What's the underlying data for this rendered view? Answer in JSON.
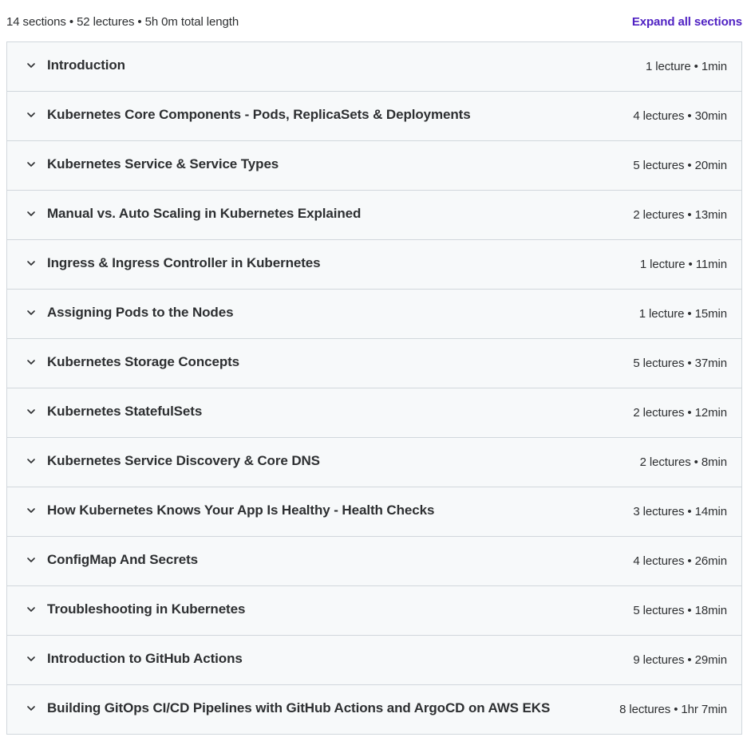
{
  "summary": {
    "text": "14 sections • 52 lectures • 5h 0m total length",
    "expand_label": "Expand all sections"
  },
  "colors": {
    "accent": "#5022c3",
    "row_background": "#f7f9fa",
    "border": "#d1d7dc",
    "text": "#2d2f31"
  },
  "sections": [
    {
      "title": "Introduction",
      "meta": "1 lecture • 1min",
      "icon": "chevron-down-icon"
    },
    {
      "title": "Kubernetes Core Components - Pods, ReplicaSets & Deployments",
      "meta": "4 lectures • 30min",
      "icon": "chevron-down-icon"
    },
    {
      "title": "Kubernetes Service & Service Types",
      "meta": "5 lectures • 20min",
      "icon": "chevron-down-icon"
    },
    {
      "title": "Manual vs. Auto Scaling in Kubernetes Explained",
      "meta": "2 lectures • 13min",
      "icon": "chevron-down-icon"
    },
    {
      "title": "Ingress & Ingress Controller in Kubernetes",
      "meta": "1 lecture • 11min",
      "icon": "chevron-down-icon"
    },
    {
      "title": "Assigning Pods to the Nodes",
      "meta": "1 lecture • 15min",
      "icon": "chevron-down-icon"
    },
    {
      "title": "Kubernetes Storage Concepts",
      "meta": "5 lectures • 37min",
      "icon": "chevron-down-icon"
    },
    {
      "title": "Kubernetes StatefulSets",
      "meta": "2 lectures • 12min",
      "icon": "chevron-down-icon"
    },
    {
      "title": "Kubernetes Service Discovery & Core DNS",
      "meta": "2 lectures • 8min",
      "icon": "chevron-down-icon"
    },
    {
      "title": "How Kubernetes Knows Your App Is Healthy - Health Checks",
      "meta": "3 lectures • 14min",
      "icon": "chevron-down-icon"
    },
    {
      "title": "ConfigMap And Secrets",
      "meta": "4 lectures • 26min",
      "icon": "chevron-down-icon"
    },
    {
      "title": "Troubleshooting in Kubernetes",
      "meta": "5 lectures • 18min",
      "icon": "chevron-down-icon"
    },
    {
      "title": "Introduction to GitHub Actions",
      "meta": "9 lectures • 29min",
      "icon": "chevron-down-icon"
    },
    {
      "title": "Building GitOps CI/CD Pipelines with GitHub Actions and ArgoCD on AWS EKS",
      "meta": "8 lectures • 1hr 7min",
      "icon": "chevron-down-icon"
    }
  ]
}
